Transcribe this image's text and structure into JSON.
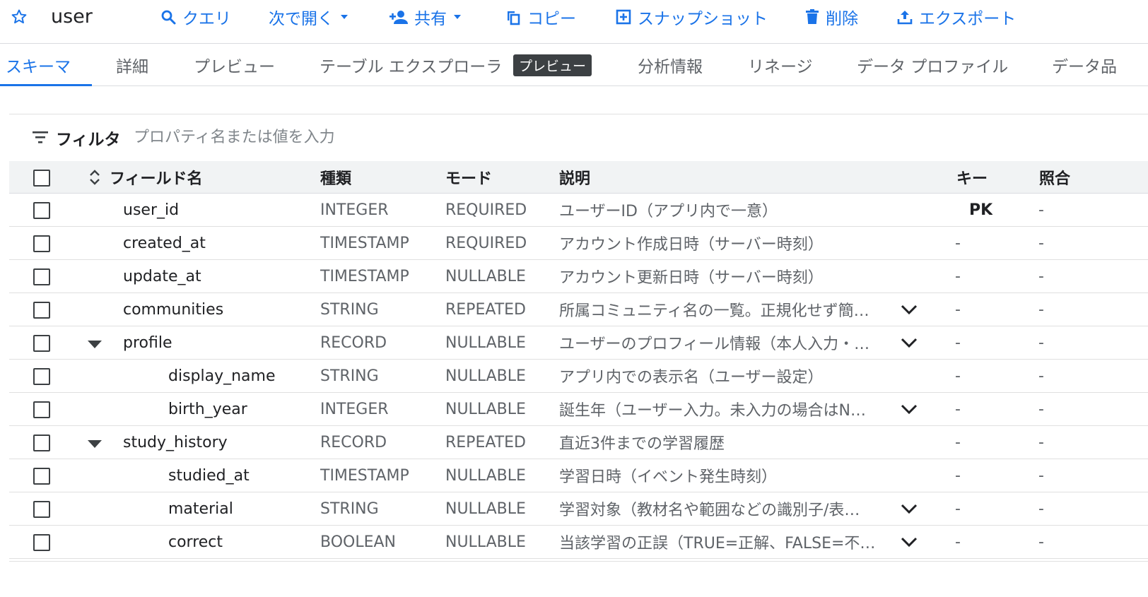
{
  "table_name": "user",
  "toolbar": {
    "query": "クエリ",
    "open_in": "次で開く",
    "share": "共有",
    "copy": "コピー",
    "snapshot": "スナップショット",
    "delete": "削除",
    "export": "エクスポート"
  },
  "tabs": [
    "スキーマ",
    "詳細",
    "プレビュー",
    "テーブル エクスプローラ",
    "分析情報",
    "リネージ",
    "データ プロファイル",
    "データ品"
  ],
  "preview_badge": "プレビュー",
  "filter": {
    "label": "フィルタ",
    "placeholder": "プロパティ名または値を入力"
  },
  "columns": {
    "field_name": "フィールド名",
    "type": "種類",
    "mode": "モード",
    "description": "説明",
    "key": "キー",
    "collation": "照合"
  },
  "rows": [
    {
      "name": "user_id",
      "level": 0,
      "type": "INTEGER",
      "mode": "REQUIRED",
      "description": "ユーザーID（アプリ内で一意）",
      "key": "PK",
      "collation": "-"
    },
    {
      "name": "created_at",
      "level": 0,
      "type": "TIMESTAMP",
      "mode": "REQUIRED",
      "description": "アカウント作成日時（サーバー時刻）",
      "key": "-",
      "collation": "-"
    },
    {
      "name": "update_at",
      "level": 0,
      "type": "TIMESTAMP",
      "mode": "NULLABLE",
      "description": "アカウント更新日時（サーバー時刻）",
      "key": "-",
      "collation": "-"
    },
    {
      "name": "communities",
      "level": 0,
      "type": "STRING",
      "mode": "REPEATED",
      "description": "所属コミュニティ名の一覧。正規化せず簡…",
      "key": "-",
      "collation": "-",
      "expandable": true
    },
    {
      "name": "profile",
      "level": 0,
      "type": "RECORD",
      "mode": "NULLABLE",
      "description": "ユーザーのプロフィール情報（本人入力・…",
      "key": "-",
      "collation": "-",
      "expandable": true,
      "record": true
    },
    {
      "name": "display_name",
      "level": 1,
      "type": "STRING",
      "mode": "NULLABLE",
      "description": "アプリ内での表示名（ユーザー設定）",
      "key": "-",
      "collation": "-"
    },
    {
      "name": "birth_year",
      "level": 1,
      "type": "INTEGER",
      "mode": "NULLABLE",
      "description": "誕生年（ユーザー入力。未入力の場合はN…",
      "key": "-",
      "collation": "-",
      "expandable": true
    },
    {
      "name": "study_history",
      "level": 0,
      "type": "RECORD",
      "mode": "REPEATED",
      "description": "直近3件までの学習履歴",
      "key": "-",
      "collation": "-",
      "record": true
    },
    {
      "name": "studied_at",
      "level": 1,
      "type": "TIMESTAMP",
      "mode": "NULLABLE",
      "description": "学習日時（イベント発生時刻）",
      "key": "-",
      "collation": "-"
    },
    {
      "name": "material",
      "level": 1,
      "type": "STRING",
      "mode": "NULLABLE",
      "description": "学習対象（教材名や範囲などの識別子/表…",
      "key": "-",
      "collation": "-",
      "expandable": true
    },
    {
      "name": "correct",
      "level": 1,
      "type": "BOOLEAN",
      "mode": "NULLABLE",
      "description": "当該学習の正誤（TRUE=正解、FALSE=不…",
      "key": "-",
      "collation": "-",
      "expandable": true
    }
  ],
  "colors": {
    "accent": "#1a73e8",
    "text": "#202124",
    "muted": "#5f6368",
    "badge": "#3c4043"
  }
}
